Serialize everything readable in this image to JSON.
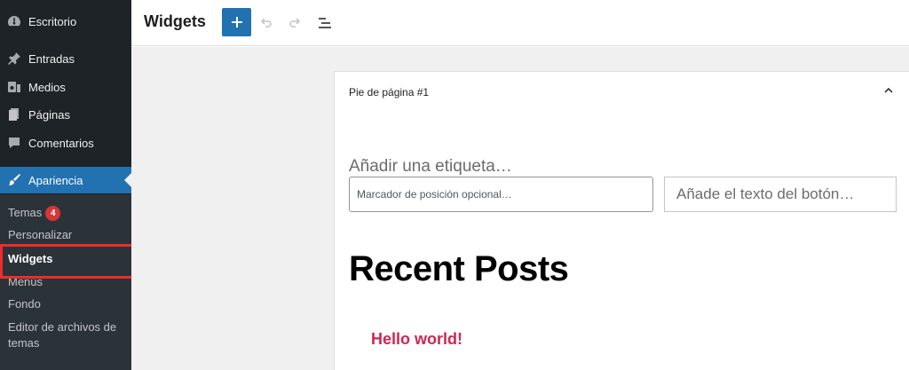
{
  "sidebar": {
    "items": [
      {
        "label": "Escritorio",
        "icon": "dashboard-icon"
      },
      {
        "label": "Entradas",
        "icon": "pushpin-icon"
      },
      {
        "label": "Medios",
        "icon": "media-icon"
      },
      {
        "label": "Páginas",
        "icon": "page-icon"
      },
      {
        "label": "Comentarios",
        "icon": "comment-icon"
      },
      {
        "label": "Apariencia",
        "icon": "brush-icon",
        "active": true
      }
    ],
    "submenu": {
      "temas": "Temas",
      "temas_badge": "4",
      "personalizar": "Personalizar",
      "widgets": "Widgets",
      "menus": "Menús",
      "fondo": "Fondo",
      "editor_line1": "Editor de archivos de",
      "editor_line2": "temas"
    }
  },
  "header": {
    "title": "Widgets",
    "add_button": "+",
    "icons": [
      "undo-icon",
      "redo-icon",
      "list-view-icon"
    ]
  },
  "widget_area": {
    "title": "Pie de página #1",
    "label_placeholder": "Añadir una etiqueta…",
    "search_placeholder": "Marcador de posición opcional…",
    "button_placeholder": "Añade el texto del botón…",
    "heading": "Recent Posts",
    "posts": [
      "Hello world!"
    ]
  },
  "colors": {
    "sidebar_bg": "#1d2327",
    "submenu_bg": "#2c3338",
    "accent": "#2271b1",
    "badge": "#d63638",
    "annotation": "#ef2b2b",
    "post_link": "#cd2653"
  }
}
